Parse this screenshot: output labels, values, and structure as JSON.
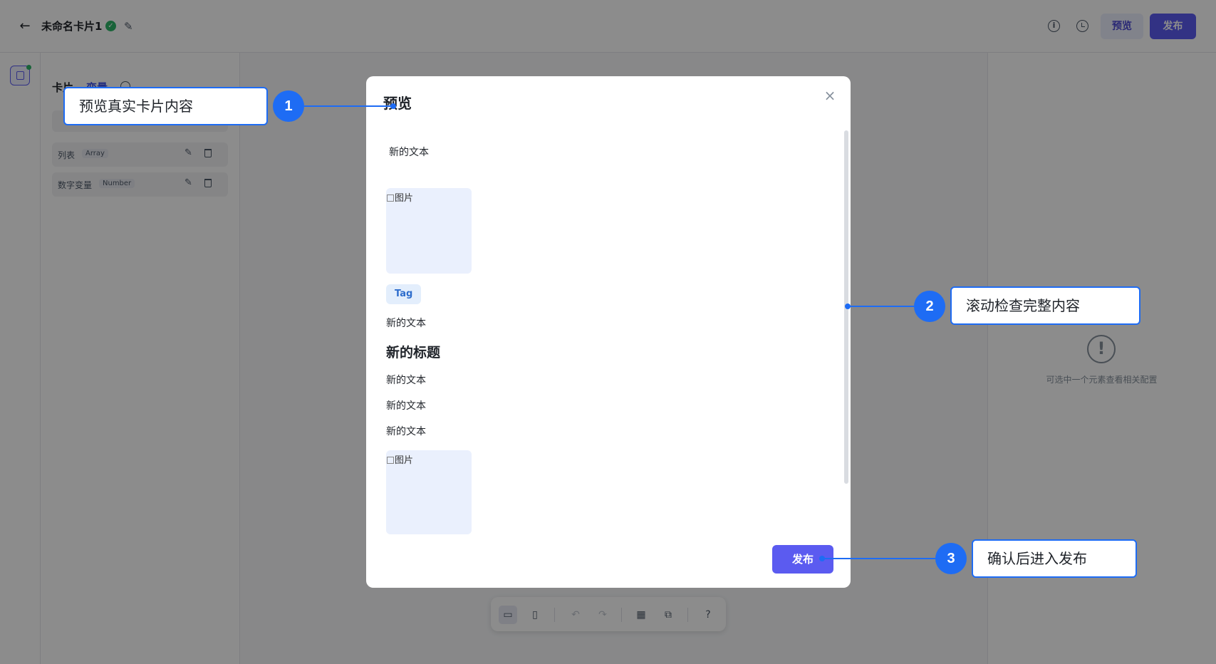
{
  "topbar": {
    "title": "未命名卡片1",
    "back_icon": "arrow-left-icon",
    "preview_label": "预览",
    "publish_label": "发布"
  },
  "sidebar": {
    "tab_card": "卡片",
    "tab_variables": "变量",
    "variables": [
      {
        "name": "列表",
        "type": "Array"
      },
      {
        "name": "数字变量",
        "type": "Number"
      }
    ]
  },
  "right_panel": {
    "empty_hint": "可选中一个元素查看相关配置"
  },
  "modal": {
    "title": "预览",
    "content": {
      "text1": "新的文本",
      "image_alt": "图片",
      "tag": "Tag",
      "text2": "新的文本",
      "heading": "新的标题",
      "text3": "新的文本",
      "text4": "新的文本",
      "text5": "新的文本",
      "image2_alt": "图片"
    },
    "publish_label": "发布"
  },
  "callouts": [
    {
      "num": "1",
      "text": "预览真实卡片内容"
    },
    {
      "num": "2",
      "text": "滚动检查完整内容"
    },
    {
      "num": "3",
      "text": "确认后进入发布"
    }
  ],
  "colors": {
    "accent": "#5b5bf0",
    "callout": "#1e6cf4",
    "success": "#2fb469"
  }
}
